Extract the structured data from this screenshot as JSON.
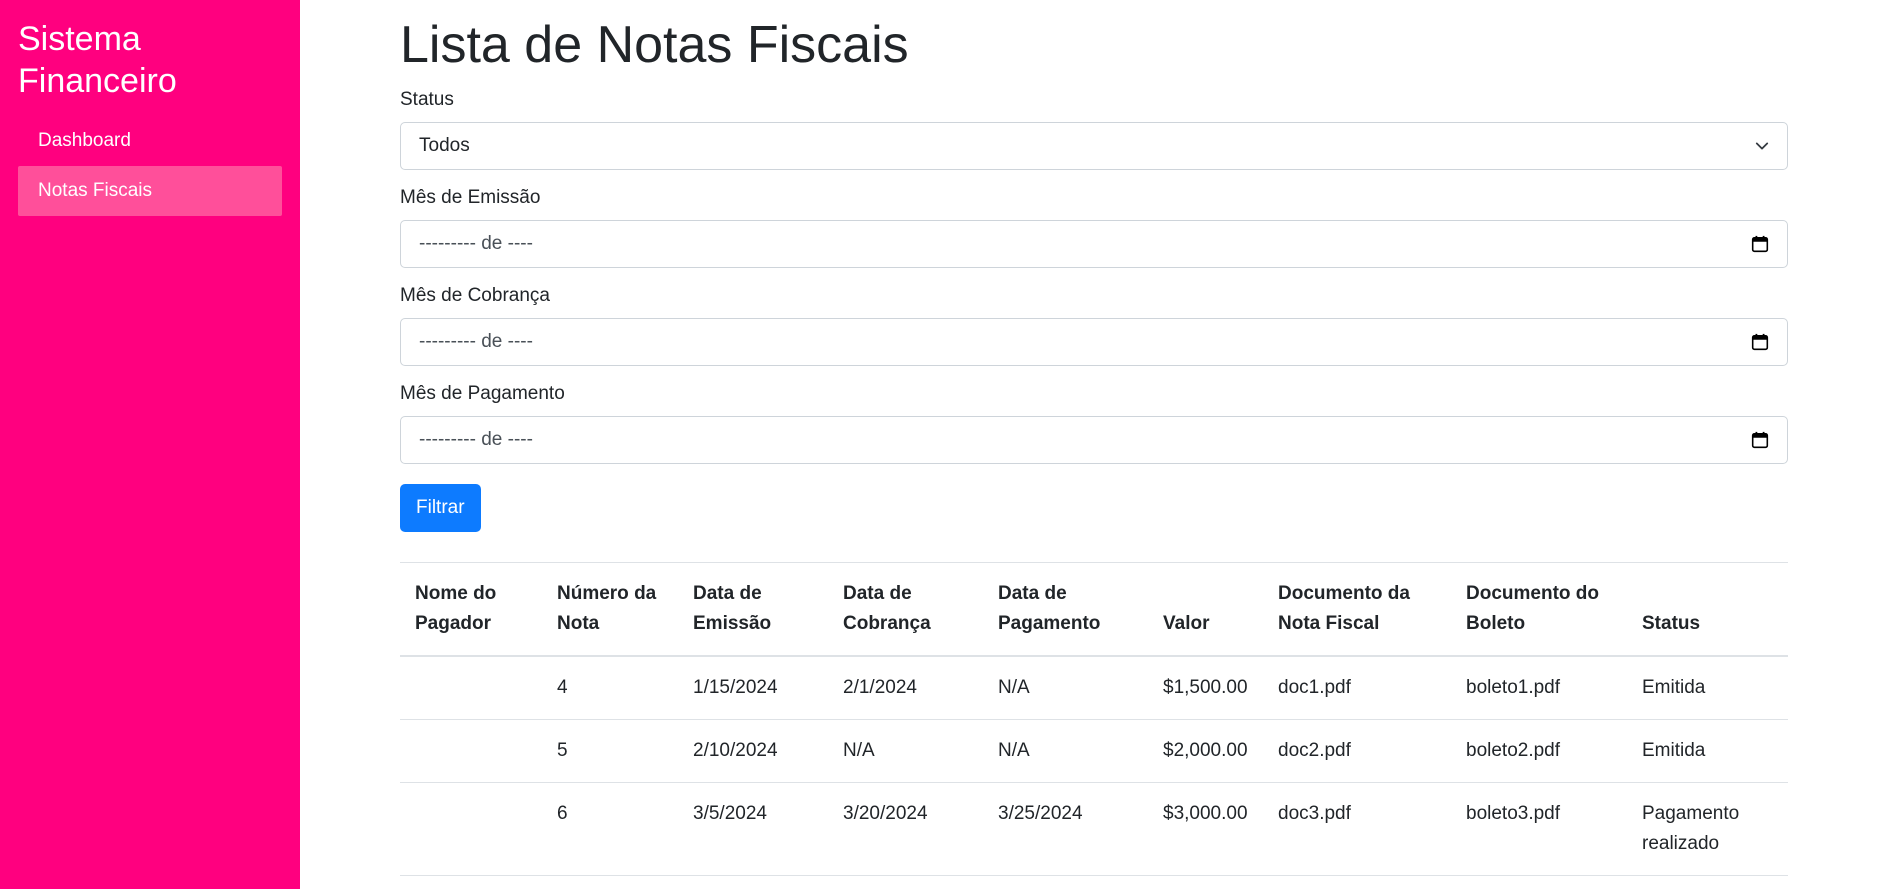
{
  "sidebar": {
    "brand": "Sistema Financeiro",
    "items": [
      {
        "label": "Dashboard",
        "active": false
      },
      {
        "label": "Notas Fiscais",
        "active": true
      }
    ]
  },
  "page": {
    "title": "Lista de Notas Fiscais"
  },
  "filters": {
    "status": {
      "label": "Status",
      "value": "Todos"
    },
    "emissao": {
      "label": "Mês de Emissão",
      "value": "--------- de ----"
    },
    "cobranca": {
      "label": "Mês de Cobrança",
      "value": "--------- de ----"
    },
    "pagamento": {
      "label": "Mês de Pagamento",
      "value": "--------- de ----"
    },
    "submit_label": "Filtrar"
  },
  "table": {
    "headers": {
      "payer": "Nome do Pagador",
      "number": "Número da Nota",
      "emissao": "Data de Emissão",
      "cobranca": "Data de Cobrança",
      "pagamento": "Data de Pagamento",
      "valor": "Valor",
      "doc": "Documento da Nota Fiscal",
      "boleto": "Documento do Boleto",
      "status": "Status"
    },
    "rows": [
      {
        "payer": "",
        "number": "4",
        "emissao": "1/15/2024",
        "cobranca": "2/1/2024",
        "pagamento": "N/A",
        "valor": "$1,500.00",
        "doc": "doc1.pdf",
        "boleto": "boleto1.pdf",
        "status": "Emitida"
      },
      {
        "payer": "",
        "number": "5",
        "emissao": "2/10/2024",
        "cobranca": "N/A",
        "pagamento": "N/A",
        "valor": "$2,000.00",
        "doc": "doc2.pdf",
        "boleto": "boleto2.pdf",
        "status": "Emitida"
      },
      {
        "payer": "",
        "number": "6",
        "emissao": "3/5/2024",
        "cobranca": "3/20/2024",
        "pagamento": "3/25/2024",
        "valor": "$3,000.00",
        "doc": "doc3.pdf",
        "boleto": "boleto3.pdf",
        "status": "Pagamento realizado"
      }
    ]
  },
  "colors": {
    "sidebar": "#ff007f",
    "active_item": "#ff4f9a",
    "primary": "#0d7bff"
  }
}
